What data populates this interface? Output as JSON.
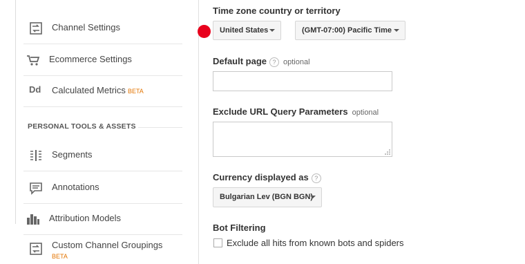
{
  "nav": {
    "items": [
      {
        "label": "Channel Settings",
        "icon": "channel-settings-icon"
      },
      {
        "label": "Ecommerce Settings",
        "icon": "cart-icon"
      },
      {
        "label": "Calculated Metrics",
        "badge": "BETA",
        "icon": "dd-icon",
        "icon_text": "Dd"
      },
      {
        "label": "Segments",
        "icon": "segments-icon"
      },
      {
        "label": "Annotations",
        "icon": "annotation-icon"
      },
      {
        "label": "Attribution Models",
        "icon": "bar-chart-icon"
      },
      {
        "label": "Custom Channel Groupings",
        "badge": "BETA",
        "icon": "channel-settings-icon"
      }
    ],
    "section_personal": "PERSONAL TOOLS & ASSETS"
  },
  "form": {
    "timezone_label": "Time zone country or territory",
    "country_value": "United States",
    "timezone_value": "(GMT-07:00) Pacific Time",
    "default_page_label": "Default page",
    "default_page_optional": "optional",
    "default_page_value": "",
    "exclude_label": "Exclude URL Query Parameters",
    "exclude_optional": "optional",
    "exclude_value": "",
    "currency_label": "Currency displayed as",
    "currency_value": "Bulgarian Lev (BGN BGN)",
    "bot_label": "Bot Filtering",
    "bot_checkbox_label": "Exclude all hits from known bots and spiders",
    "help_glyph": "?"
  },
  "colors": {
    "beta": "#e37400",
    "marker": "#e8001c"
  }
}
